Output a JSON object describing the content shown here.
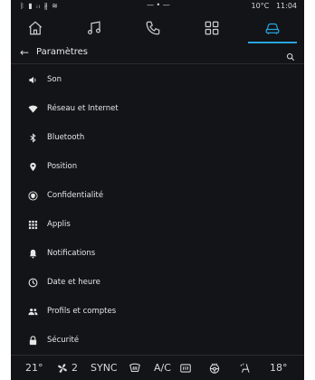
{
  "status": {
    "left": "ᛒ ▮ ᵢₗ ∦ ≋",
    "center": "— • —",
    "temp": "10°C",
    "time": "11:04"
  },
  "nav": {
    "tabs": [
      {
        "name": "home"
      },
      {
        "name": "music"
      },
      {
        "name": "phone"
      },
      {
        "name": "apps"
      },
      {
        "name": "vehicle"
      }
    ]
  },
  "header": {
    "back": "←",
    "title": "Paramètres"
  },
  "menu": [
    {
      "label": "Son",
      "icon": "speaker-icon"
    },
    {
      "label": "Réseau et Internet",
      "icon": "wifi-icon"
    },
    {
      "label": "Bluetooth",
      "icon": "bluetooth-icon"
    },
    {
      "label": "Position",
      "icon": "location-pin-icon"
    },
    {
      "label": "Confidentialité",
      "icon": "privacy-shield-icon"
    },
    {
      "label": "Applis",
      "icon": "apps-grid-icon"
    },
    {
      "label": "Notifications",
      "icon": "bell-icon"
    },
    {
      "label": "Date et heure",
      "icon": "clock-icon"
    },
    {
      "label": "Profils et comptes",
      "icon": "people-icon"
    },
    {
      "label": "Sécurité",
      "icon": "lock-icon"
    }
  ],
  "climate": {
    "left_temp": "21°",
    "fan_speed": "2",
    "sync_label": "SYNC",
    "ac_label": "A/C",
    "right_temp": "18°"
  }
}
